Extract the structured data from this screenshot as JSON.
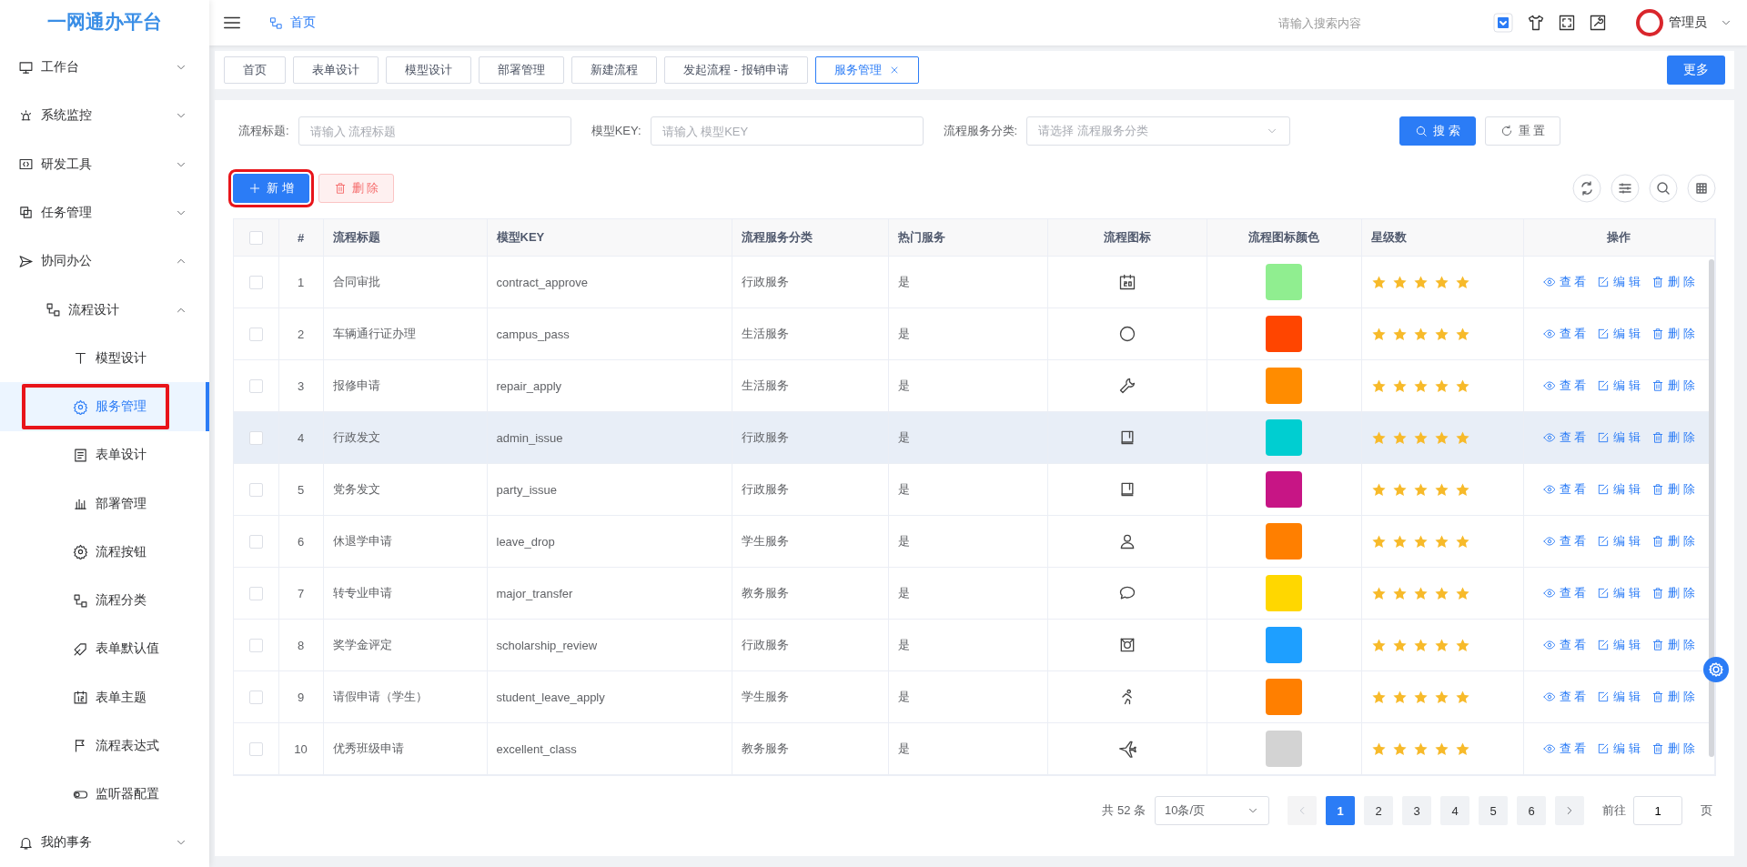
{
  "header": {
    "logo": "一网通办平台",
    "breadcrumb": "首页",
    "search": {
      "placeholder": "请输入搜索内容"
    },
    "user": "管理员"
  },
  "sidebar": {
    "items": [
      {
        "label": "工作台",
        "kind": "monitor",
        "expanded": false
      },
      {
        "label": "系统监控",
        "kind": "alarm",
        "expanded": false
      },
      {
        "label": "研发工具",
        "kind": "code",
        "expanded": false
      },
      {
        "label": "任务管理",
        "kind": "copy",
        "expanded": false
      },
      {
        "label": "协同办公",
        "kind": "send",
        "expanded": true,
        "children": [
          {
            "label": "流程设计",
            "kind": "flow",
            "expanded": true,
            "children": [
              {
                "label": "模型设计",
                "kind": "text",
                "selected": false,
                "outlined": false
              },
              {
                "label": "服务管理",
                "kind": "gear",
                "selected": true,
                "outlined": true
              },
              {
                "label": "表单设计",
                "kind": "doc",
                "selected": false,
                "outlined": false
              },
              {
                "label": "部署管理",
                "kind": "bars",
                "selected": false,
                "outlined": false
              },
              {
                "label": "流程按钮",
                "kind": "gear",
                "selected": false,
                "outlined": false
              },
              {
                "label": "流程分类",
                "kind": "flow",
                "selected": false,
                "outlined": false
              },
              {
                "label": "表单默认值",
                "kind": "tag",
                "selected": false,
                "outlined": false
              },
              {
                "label": "表单主题",
                "kind": "cal12",
                "selected": false,
                "outlined": false
              },
              {
                "label": "流程表达式",
                "kind": "flag",
                "selected": false,
                "outlined": false
              },
              {
                "label": "监听器配置",
                "kind": "toggle",
                "selected": false,
                "outlined": false
              }
            ]
          }
        ]
      },
      {
        "label": "我的事务",
        "kind": "bell",
        "expanded": false
      }
    ]
  },
  "tabs": [
    {
      "label": "首页",
      "selected": false
    },
    {
      "label": "表单设计",
      "selected": false
    },
    {
      "label": "模型设计",
      "selected": false
    },
    {
      "label": "部署管理",
      "selected": false
    },
    {
      "label": "新建流程",
      "selected": false
    },
    {
      "label": "发起流程 - 报销申请",
      "selected": false
    },
    {
      "label": "服务管理",
      "selected": true
    }
  ],
  "more_button": "更多",
  "filters": [
    {
      "label": "流程标题:",
      "kind": "input",
      "placeholder": "请输入 流程标题"
    },
    {
      "label": "模型KEY:",
      "kind": "input",
      "placeholder": "请输入 模型KEY"
    },
    {
      "label": "流程服务分类:",
      "kind": "select",
      "placeholder": "请选择 流程服务分类"
    }
  ],
  "search_button": "搜 索",
  "reset_button": "重 置",
  "add_button": {
    "label": "新 增",
    "outlined": true
  },
  "delete_button": {
    "label": "删 除",
    "disabled": true
  },
  "table": {
    "all_checked": false,
    "columns": [
      "#",
      "流程标题",
      "模型KEY",
      "流程服务分类",
      "热门服务",
      "流程图标",
      "流程图标颜色",
      "星级数",
      "操作"
    ],
    "rows": [
      {
        "checked": false,
        "hovered": false,
        "index": "1",
        "title": "合同审批",
        "key": "contract_approve",
        "category": "行政服务",
        "hot": "是",
        "kind": "calendar",
        "color": "#90ee90",
        "stars": 5,
        "actions": [
          "查 看",
          "编 辑",
          "删 除"
        ]
      },
      {
        "checked": false,
        "hovered": false,
        "index": "2",
        "title": "车辆通行证办理",
        "key": "campus_pass",
        "category": "生活服务",
        "hot": "是",
        "kind": "circle",
        "color": "#ff4500",
        "stars": 5,
        "actions": [
          "查 看",
          "编 辑",
          "删 除"
        ]
      },
      {
        "checked": false,
        "hovered": false,
        "index": "3",
        "title": "报修申请",
        "key": "repair_apply",
        "category": "生活服务",
        "hot": "是",
        "kind": "wrench",
        "color": "#ff8c00",
        "stars": 5,
        "actions": [
          "查 看",
          "编 辑",
          "删 除"
        ]
      },
      {
        "checked": false,
        "hovered": true,
        "index": "4",
        "title": "行政发文",
        "key": "admin_issue",
        "category": "行政服务",
        "hot": "是",
        "kind": "book",
        "color": "#00ced1",
        "stars": 5,
        "actions": [
          "查 看",
          "编 辑",
          "删 除"
        ]
      },
      {
        "checked": false,
        "hovered": false,
        "index": "5",
        "title": "党务发文",
        "key": "party_issue",
        "category": "行政服务",
        "hot": "是",
        "kind": "book",
        "color": "#c71585",
        "stars": 5,
        "actions": [
          "查 看",
          "编 辑",
          "删 除"
        ]
      },
      {
        "checked": false,
        "hovered": false,
        "index": "6",
        "title": "休退学申请",
        "key": "leave_drop",
        "category": "学生服务",
        "hot": "是",
        "kind": "user",
        "color": "#ff7f00",
        "stars": 5,
        "actions": [
          "查 看",
          "编 辑",
          "删 除"
        ]
      },
      {
        "checked": false,
        "hovered": false,
        "index": "7",
        "title": "转专业申请",
        "key": "major_transfer",
        "category": "教务服务",
        "hot": "是",
        "kind": "chat",
        "color": "#ffd700",
        "stars": 5,
        "actions": [
          "查 看",
          "编 辑",
          "删 除"
        ]
      },
      {
        "checked": false,
        "hovered": false,
        "index": "8",
        "title": "奖学金评定",
        "key": "scholarship_review",
        "category": "行政服务",
        "hot": "是",
        "kind": "medal",
        "color": "#1e9fff",
        "stars": 5,
        "actions": [
          "查 看",
          "编 辑",
          "删 除"
        ]
      },
      {
        "checked": false,
        "hovered": false,
        "index": "9",
        "title": "请假申请（学生）",
        "key": "student_leave_apply",
        "category": "学生服务",
        "hot": "是",
        "kind": "runner",
        "color": "#ff7f00",
        "stars": 5,
        "actions": [
          "查 看",
          "编 辑",
          "删 除"
        ]
      },
      {
        "checked": false,
        "hovered": false,
        "index": "10",
        "title": "优秀班级申请",
        "key": "excellent_class",
        "category": "教务服务",
        "hot": "是",
        "kind": "plane",
        "color": "#d3d3d3",
        "stars": 5,
        "actions": [
          "查 看",
          "编 辑",
          "删 除"
        ]
      }
    ]
  },
  "pagination": {
    "total": "共 52 条",
    "page_size": "10条/页",
    "prev_disabled": true,
    "pages": [
      {
        "label": "1",
        "selected": true
      },
      {
        "label": "2",
        "selected": false
      },
      {
        "label": "3",
        "selected": false
      },
      {
        "label": "4",
        "selected": false
      },
      {
        "label": "5",
        "selected": false
      },
      {
        "label": "6",
        "selected": false
      }
    ],
    "goto_label": "前往",
    "goto_value": "1",
    "page_suffix": "页"
  }
}
